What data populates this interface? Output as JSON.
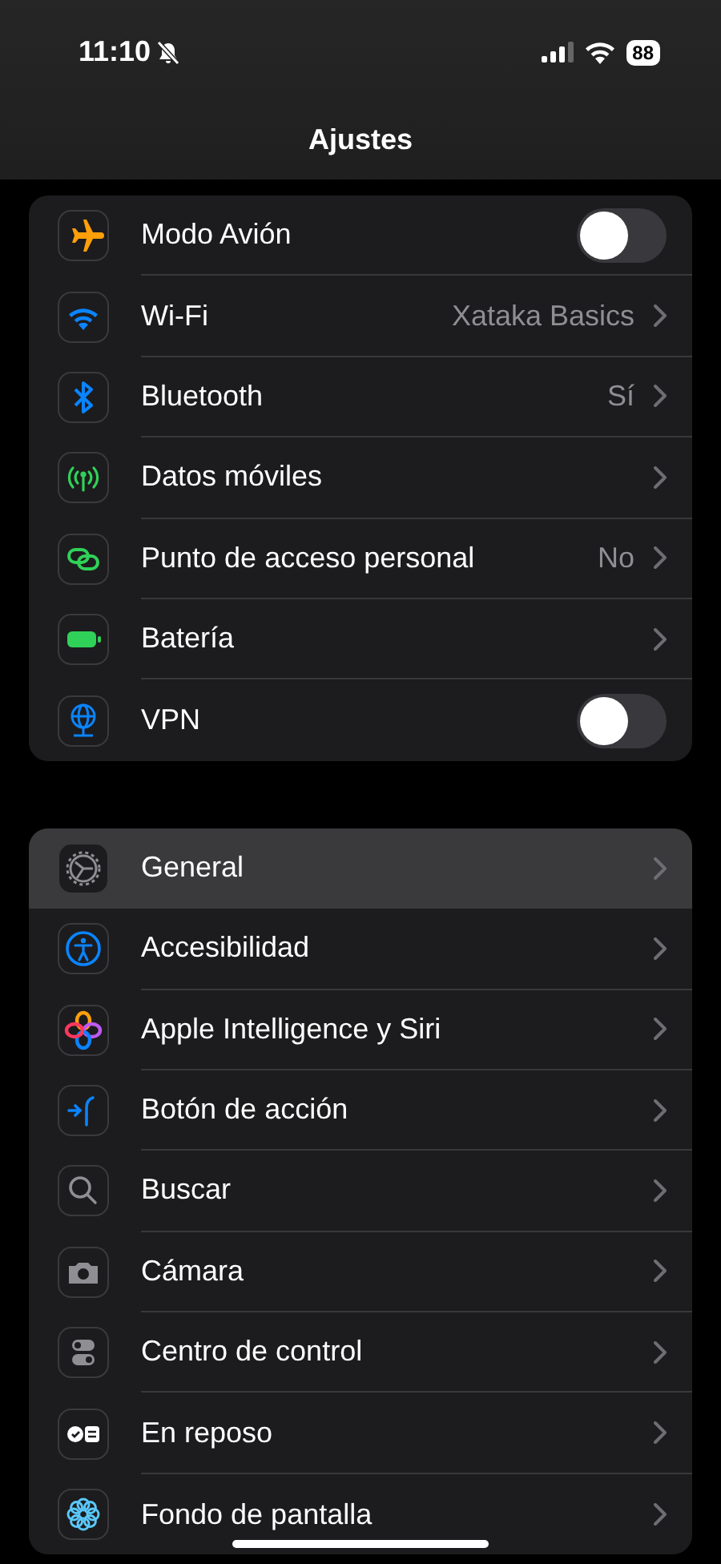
{
  "status_bar": {
    "time": "11:10",
    "battery": "88"
  },
  "title": "Ajustes",
  "groups": [
    {
      "rows": [
        {
          "kind": "toggle",
          "label": "Modo Avión",
          "on": false
        },
        {
          "kind": "link",
          "label": "Wi-Fi",
          "value": "Xataka Basics"
        },
        {
          "kind": "link",
          "label": "Bluetooth",
          "value": "Sí"
        },
        {
          "kind": "link",
          "label": "Datos móviles"
        },
        {
          "kind": "link",
          "label": "Punto de acceso personal",
          "value": "No"
        },
        {
          "kind": "link",
          "label": "Batería"
        },
        {
          "kind": "toggle",
          "label": "VPN",
          "on": false
        }
      ]
    },
    {
      "rows": [
        {
          "kind": "link",
          "label": "General",
          "selected": true
        },
        {
          "kind": "link",
          "label": "Accesibilidad",
          "selected": false
        },
        {
          "kind": "link",
          "label": "Apple Intelligence y Siri",
          "selected": false
        },
        {
          "kind": "link",
          "label": "Botón de acción",
          "selected": false
        },
        {
          "kind": "link",
          "label": "Buscar",
          "selected": false
        },
        {
          "kind": "link",
          "label": "Cámara",
          "selected": false
        },
        {
          "kind": "link",
          "label": "Centro de control",
          "selected": false
        },
        {
          "kind": "link",
          "label": "En reposo",
          "selected": false
        },
        {
          "kind": "link",
          "label": "Fondo de pantalla",
          "selected": false
        }
      ]
    }
  ]
}
